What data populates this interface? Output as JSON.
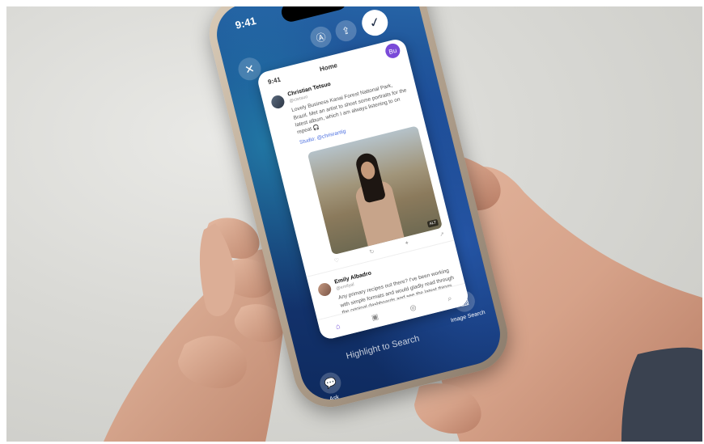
{
  "phone": {
    "time": "9:41",
    "status_icons": "▮▮▮ ◠ ▬",
    "icons": {
      "close": "✕",
      "translate": "Ⓐ",
      "share": "⇪",
      "done": "✓"
    }
  },
  "captured_app": {
    "time": "9:41",
    "title": "Home",
    "avatar_initials": "Bu",
    "post1": {
      "name": "Christian Tetsuo",
      "meta": "@ctetsuo",
      "body": "Lovely Business Kanai Forest National Park, Brazil. Met an artist to shoot some portraits for the latest album, which I am always listening to on repeat 🎧",
      "link": "Studio: @chrisrantig"
    },
    "photo_badge": "ALT",
    "actions": [
      "♡",
      "↻",
      "✦",
      "↗"
    ],
    "post2": {
      "name": "Emily Albadro",
      "meta": "@emilyal",
      "body": "Any primary recipes out there? I've been working with simple formats and would gladly read through the original dashboards and see the latest things first."
    },
    "tabs": [
      "⌂",
      "▣",
      "◎",
      "⌕"
    ]
  },
  "overlay": {
    "highlight_text": "Highlight to Search",
    "ask_label": "Ask",
    "ask_icon": "💬",
    "image_search_label": "Image Search",
    "image_search_icon": "▨"
  }
}
